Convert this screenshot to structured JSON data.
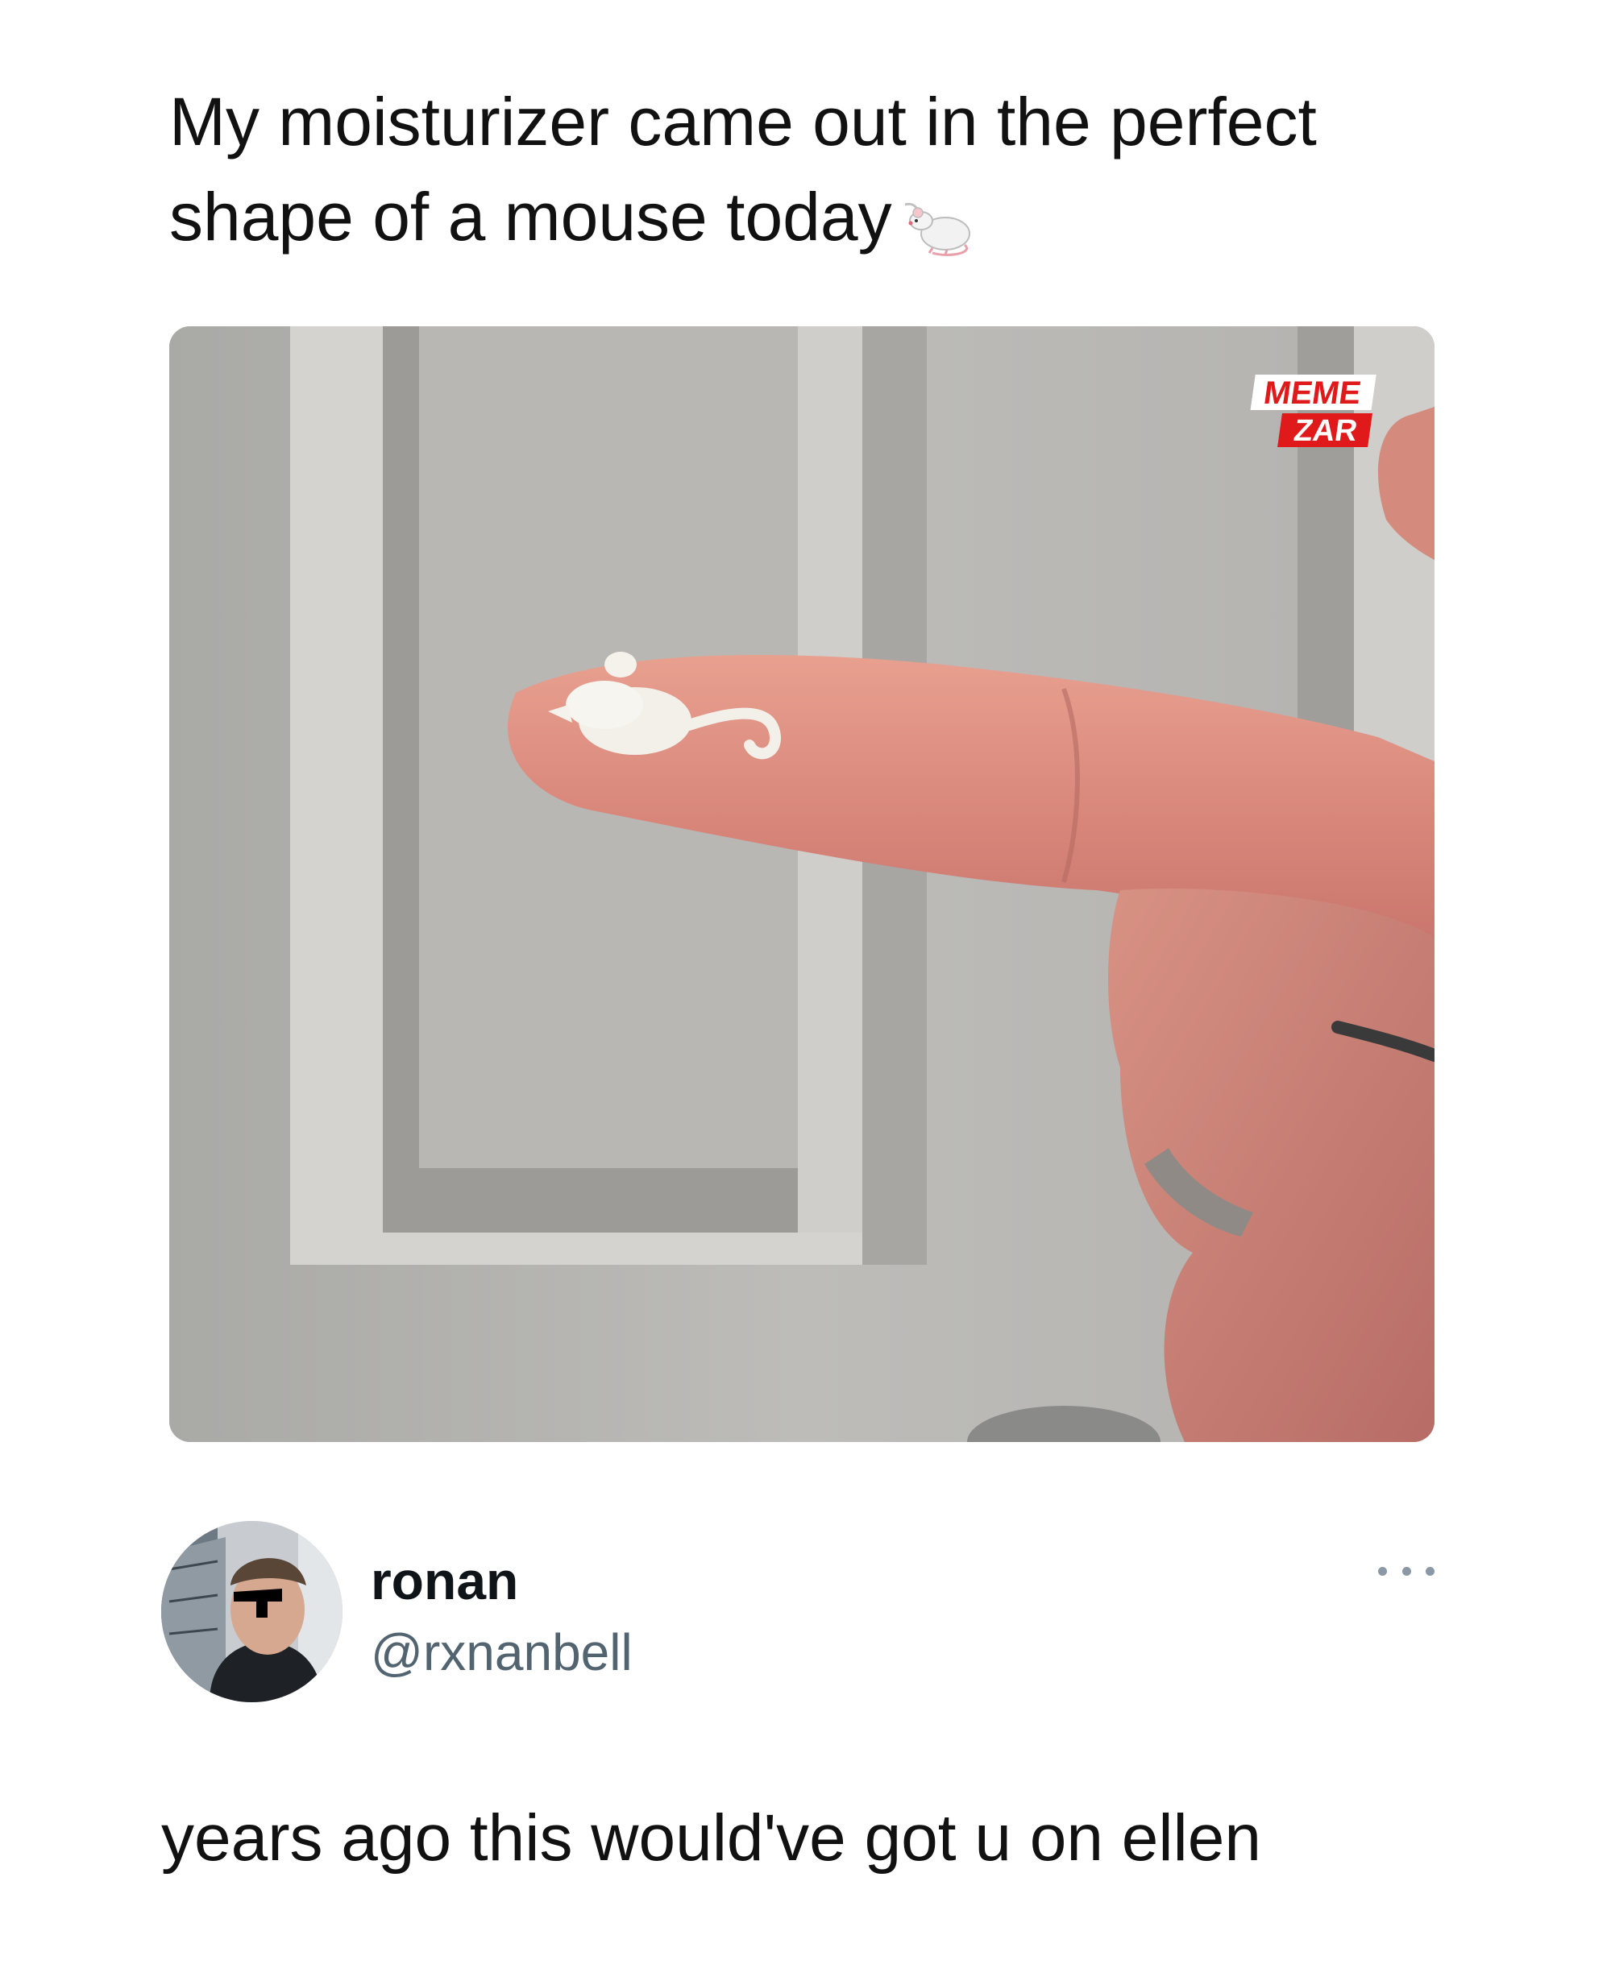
{
  "post": {
    "caption_line1": "My moisturizer came out in the perfect",
    "caption_line2": "shape of a mouse today",
    "caption_emoji": "mouse-emoji",
    "photo": {
      "description_icon": "photo-finger-with-moisturizer-mouse",
      "watermark_line1": "MEME",
      "watermark_line2": "ZAR"
    }
  },
  "reply": {
    "author": {
      "display_name": "ronan",
      "handle": "@rxnanbell",
      "avatar_icon": "profile-avatar"
    },
    "more_icon": "ellipsis-icon",
    "text": "years ago this would've got u on ellen"
  },
  "colors": {
    "text_primary": "#0f1419",
    "text_secondary": "#536471",
    "watermark_red": "#e0191b",
    "background": "#ffffff"
  }
}
